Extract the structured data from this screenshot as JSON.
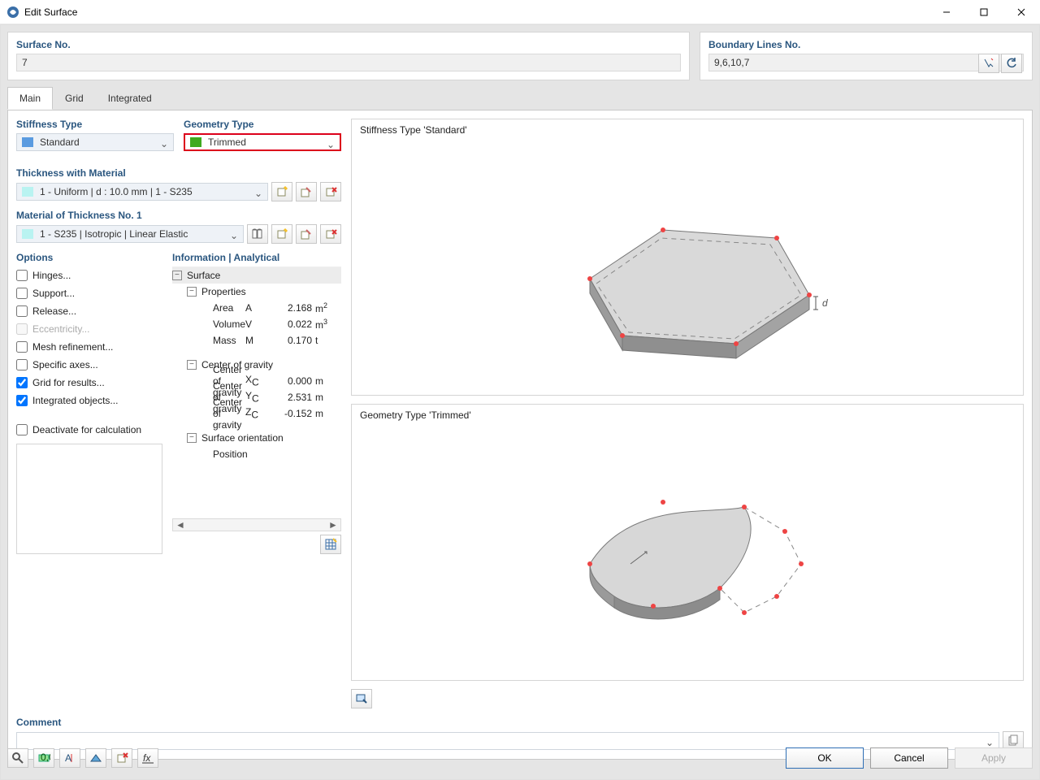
{
  "window": {
    "title": "Edit Surface"
  },
  "surface_no": {
    "label": "Surface No.",
    "value": "7"
  },
  "boundary": {
    "label": "Boundary Lines No.",
    "value": "9,6,10,7"
  },
  "tabs": {
    "main": "Main",
    "grid": "Grid",
    "integrated": "Integrated"
  },
  "stiffness": {
    "section": "Stiffness Type",
    "value": "Standard"
  },
  "geometry": {
    "section": "Geometry Type",
    "value": "Trimmed"
  },
  "thickness": {
    "section": "Thickness with Material",
    "value": "1 - Uniform | d : 10.0 mm | 1 - S235"
  },
  "material": {
    "section": "Material of Thickness No. 1",
    "value": "1 - S235 | Isotropic | Linear Elastic"
  },
  "options": {
    "section": "Options",
    "items": [
      {
        "label": "Hinges...",
        "checked": false,
        "disabled": false
      },
      {
        "label": "Support...",
        "checked": false,
        "disabled": false
      },
      {
        "label": "Release...",
        "checked": false,
        "disabled": false
      },
      {
        "label": "Eccentricity...",
        "checked": false,
        "disabled": true
      },
      {
        "label": "Mesh refinement...",
        "checked": false,
        "disabled": false
      },
      {
        "label": "Specific axes...",
        "checked": false,
        "disabled": false
      },
      {
        "label": "Grid for results...",
        "checked": true,
        "disabled": false
      },
      {
        "label": "Integrated objects...",
        "checked": true,
        "disabled": false
      }
    ],
    "deactivate": "Deactivate for calculation"
  },
  "info": {
    "section": "Information | Analytical",
    "surface": "Surface",
    "properties": "Properties",
    "area": {
      "name": "Area",
      "sym": "A",
      "val": "2.168",
      "unit": "m",
      "sup": "2"
    },
    "volume": {
      "name": "Volume",
      "sym": "V",
      "val": "0.022",
      "unit": "m",
      "sup": "3"
    },
    "mass": {
      "name": "Mass",
      "sym": "M",
      "val": "0.170",
      "unit": "t",
      "sup": ""
    },
    "cog_hdr": "Center of gravity",
    "xc": {
      "name": "Center of gravity",
      "sym": "Xc",
      "val": "0.000",
      "unit": "m"
    },
    "yc": {
      "name": "Center of gravity",
      "sym": "Yc",
      "val": "2.531",
      "unit": "m"
    },
    "zc": {
      "name": "Center of gravity",
      "sym": "Zc",
      "val": "-0.152",
      "unit": "m"
    },
    "orient": "Surface orientation",
    "position": "Position"
  },
  "preview": {
    "stiffness_title": "Stiffness Type 'Standard'",
    "geometry_title": "Geometry Type 'Trimmed'"
  },
  "comment": {
    "section": "Comment",
    "value": ""
  },
  "buttons": {
    "ok": "OK",
    "cancel": "Cancel",
    "apply": "Apply"
  }
}
